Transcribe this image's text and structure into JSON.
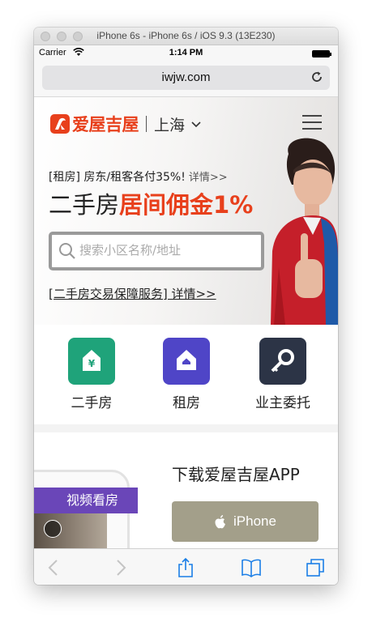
{
  "simulator": {
    "title": "iPhone 6s - iPhone 6s / iOS 9.3 (13E230)"
  },
  "status_bar": {
    "carrier": "Carrier",
    "time": "1:14 PM"
  },
  "browser": {
    "url": "iwjw.com"
  },
  "header": {
    "brand": "爱屋吉屋",
    "city": "上海"
  },
  "hero": {
    "promo_tag": "[租房] 房东/租客各付35%!",
    "promo_more": "详情>>",
    "headline_plain": "二手房",
    "headline_highlight": "居间佣金1%",
    "search_placeholder": "搜索小区名称/地址",
    "guarantee_link": "[二手房交易保障服务] 详情>>"
  },
  "quick_links": [
    {
      "label": "二手房",
      "icon": "second-hand-house-icon",
      "color": "#1fa37a"
    },
    {
      "label": "租房",
      "icon": "rent-house-icon",
      "color": "#4f45c7"
    },
    {
      "label": "业主委托",
      "icon": "key-icon",
      "color": "#2c3446"
    }
  ],
  "app_section": {
    "title": "下载爱屋吉屋APP",
    "video_label": "视频看房",
    "iphone_button": "iPhone"
  },
  "colors": {
    "brand": "#e8401c",
    "app_button": "#a39f8a",
    "video_tag": "#6a46b8"
  }
}
